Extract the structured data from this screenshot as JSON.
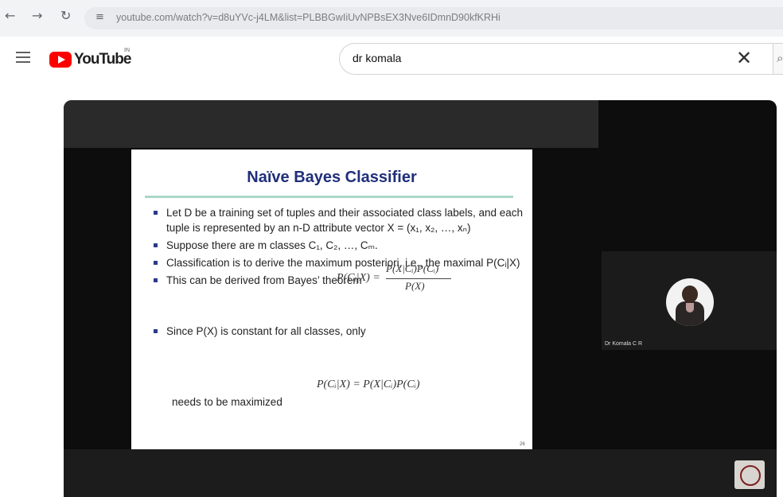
{
  "browser": {
    "url": "youtube.com/watch?v=d8uYVc-j4LM&list=PLBBGwIiUvNPBsEX3Nve6IDmnD90kfKRHi",
    "site_info_icon": "tune-icon",
    "back_icon": "←",
    "forward_icon": "→",
    "reload_icon": "↻"
  },
  "header": {
    "logo_text": "YouTube",
    "country_code": "IN",
    "search_value": "dr komala",
    "clear_icon": "✕",
    "search_icon": "⌕"
  },
  "video": {
    "slide": {
      "title": "Naïve Bayes Classifier",
      "bullets": [
        "Let D be a training set of tuples and their associated class labels, and each tuple is represented by an n-D attribute vector X = (x₁, x₂, …, xₙ)",
        "Suppose there are m classes C₁, C₂, …, Cₘ.",
        "Classification is to derive the maximum posteriori, i.e., the maximal P(Cᵢ|X)",
        "This can be derived from Bayes’ theorem",
        "Since P(X) is constant for all classes, only"
      ],
      "formula1_lhs": "P(Cᵢ|X) =",
      "formula1_num": "P(X|Cᵢ)P(Cᵢ)",
      "formula1_den": "P(X)",
      "formula2": "P(Cᵢ|X) = P(X|Cᵢ)P(Cᵢ)",
      "footer": "needs to be maximized",
      "page_number": "26"
    },
    "participant_name": "Dr Komala C R"
  },
  "colors": {
    "youtube_red": "#ff0000",
    "slide_title": "#1f2f7a",
    "slide_rule": "#a8d8c8"
  }
}
